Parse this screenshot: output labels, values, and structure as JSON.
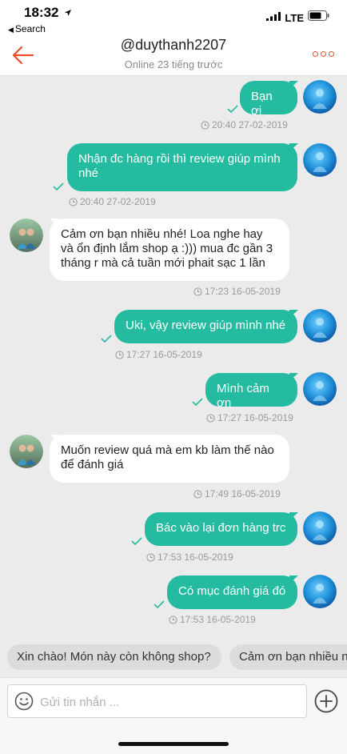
{
  "status_bar": {
    "time": "18:32",
    "back_app": "Search",
    "network": "LTE"
  },
  "header": {
    "title": "@duythanh2207",
    "status": "Online 23 tiếng trước"
  },
  "messages": [
    {
      "from": "me",
      "text": "Bạn ơi",
      "time": "20:40 27-02-2019"
    },
    {
      "from": "me",
      "text": "Nhận đc hàng rồi thì review giúp mình nhé",
      "time": "20:40 27-02-2019"
    },
    {
      "from": "them",
      "text": "Cảm ơn bạn nhiều nhé! Loa nghe hay và ổn định lắm shop ạ :))) mua đc gần 3 tháng r mà cả tuần mới phait sạc 1 lần",
      "time": "17:23 16-05-2019"
    },
    {
      "from": "me",
      "text": "Uki, vậy review giúp mình nhé",
      "time": "17:27 16-05-2019"
    },
    {
      "from": "me",
      "text": "Mình cảm ơn",
      "time": "17:27 16-05-2019"
    },
    {
      "from": "them",
      "text": "Muốn review quá mà em kb làm thế nào để đánh giá",
      "time": "17:49 16-05-2019"
    },
    {
      "from": "me",
      "text": "Bác vào lại đơn hàng trc",
      "time": "17:53 16-05-2019"
    },
    {
      "from": "me",
      "text": "Có mục đánh giá đó",
      "time": "17:53 16-05-2019"
    }
  ],
  "quick_replies": [
    "Xin chào! Món này còn không shop?",
    "Cảm ơn bạn nhiều n"
  ],
  "input": {
    "placeholder": "Gửi tin nhắn ...",
    "value": ""
  },
  "colors": {
    "accent": "#ee4d2d",
    "bubble_me": "#25bba0",
    "bubble_them": "#ffffff",
    "background": "#ebebeb"
  },
  "icons": [
    "location-arrow-icon",
    "back-arrow-icon",
    "more-icon",
    "check-icon",
    "clock-icon",
    "emoji-icon",
    "add-icon"
  ]
}
